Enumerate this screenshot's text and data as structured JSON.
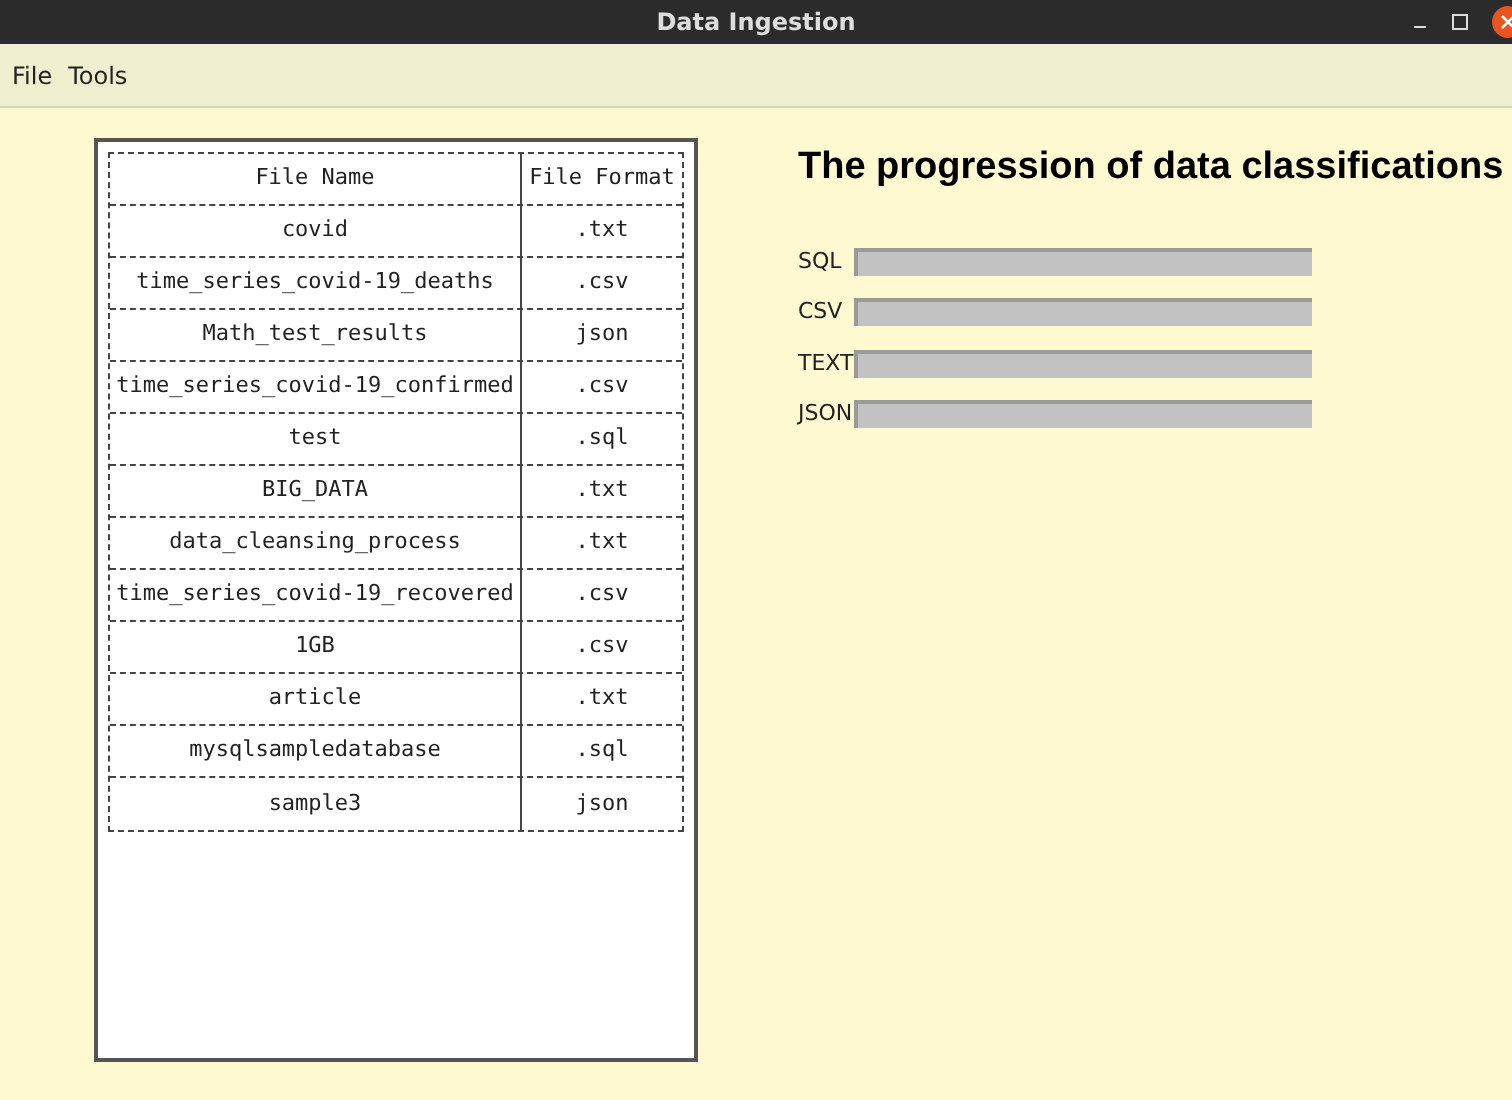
{
  "window": {
    "title": "Data Ingestion"
  },
  "menu": [
    "File",
    "Tools"
  ],
  "table": {
    "columns": [
      "File Name",
      "File Format"
    ],
    "rows": [
      [
        "covid",
        ".txt"
      ],
      [
        "time_series_covid-19_deaths",
        ".csv"
      ],
      [
        "Math_test_results",
        "json"
      ],
      [
        "time_series_covid-19_confirmed",
        ".csv"
      ],
      [
        "test",
        ".sql"
      ],
      [
        "BIG_DATA",
        ".txt"
      ],
      [
        "data_cleansing_process",
        ".txt"
      ],
      [
        "time_series_covid-19_recovered",
        ".csv"
      ],
      [
        "1GB",
        ".csv"
      ],
      [
        "article",
        ".txt"
      ],
      [
        "mysqlsampledatabase",
        ".sql"
      ],
      [
        "sample3",
        "json"
      ]
    ]
  },
  "heading": "The progression of data classifications",
  "progress": [
    {
      "label": "SQL",
      "level": 0
    },
    {
      "label": "CSV",
      "level": 0
    },
    {
      "label": "TEXT",
      "level": 0
    },
    {
      "label": "JSON",
      "level": 0
    }
  ]
}
